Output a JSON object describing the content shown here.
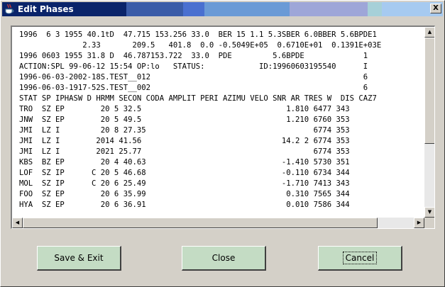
{
  "window": {
    "title": "Edit Phases",
    "close_glyph": "X",
    "titlebar_colors": [
      "#0a246a",
      "#2c3f8a",
      "#5a7fc7",
      "#4e74d4",
      "#6fa0d8",
      "#8ea9d8",
      "#a6a6d8",
      "#c0d4e8",
      "#a6caf0"
    ]
  },
  "phase_text": {
    "lines": [
      "1996  6 3 1955 40.1tD  47.715 153.256 33.0  BER 15 1.1 5.3SBER 6.0BBER 5.6BPDE1",
      "              2.33       209.5   401.8  0.0 -0.5049E+05  0.6710E+01  0.1391E+03E",
      "1996 0603 1955 31.8 D  46.787153.722  33.0  PDE         5.6BPDE             1",
      "ACTION:SPL 99-06-12 15:54 OP:lo   STATUS:            ID:19960603195540      I",
      "1996-06-03-2002-18S.TEST__012                                               6",
      "1996-06-03-1917-52S.TEST__002                                               6",
      "STAT SP IPHASW D HRMM SECON CODA AMPLIT PERI AZIMU VELO SNR AR TRES W  DIS CAZ7",
      "TRO  SZ EP        20 5 32.5                                1.810 6477 343",
      "JNW  SZ EP        20 5 49.5                                1.210 6760 353",
      "JMI  LZ I         20 8 27.35                                     6774 353",
      "JMI  LZ I        2014 41.56                               14.2 2 6774 353",
      "JMI  LZ I        2021 25.77                                      6774 353",
      "KBS  BZ EP        20 4 40.63                              -1.410 5730 351",
      "LOF  SZ IP      C 20 5 46.68                              -0.110 6734 344",
      "MOL  SZ IP      C 20 6 25.49                              -1.710 7413 343",
      "FOO  SZ EP        20 6 35.99                               0.310 7565 344",
      "HYA  SZ EP        20 6 36.91                               0.010 7586 344"
    ]
  },
  "buttons": {
    "save_exit": "Save & Exit",
    "close": "Close",
    "cancel": "Cancel"
  },
  "icons": {
    "app": "java-cup-icon",
    "scroll_up": "arrow-up-icon",
    "scroll_down": "arrow-down-icon",
    "scroll_left": "arrow-left-icon",
    "scroll_right": "arrow-right-icon"
  }
}
